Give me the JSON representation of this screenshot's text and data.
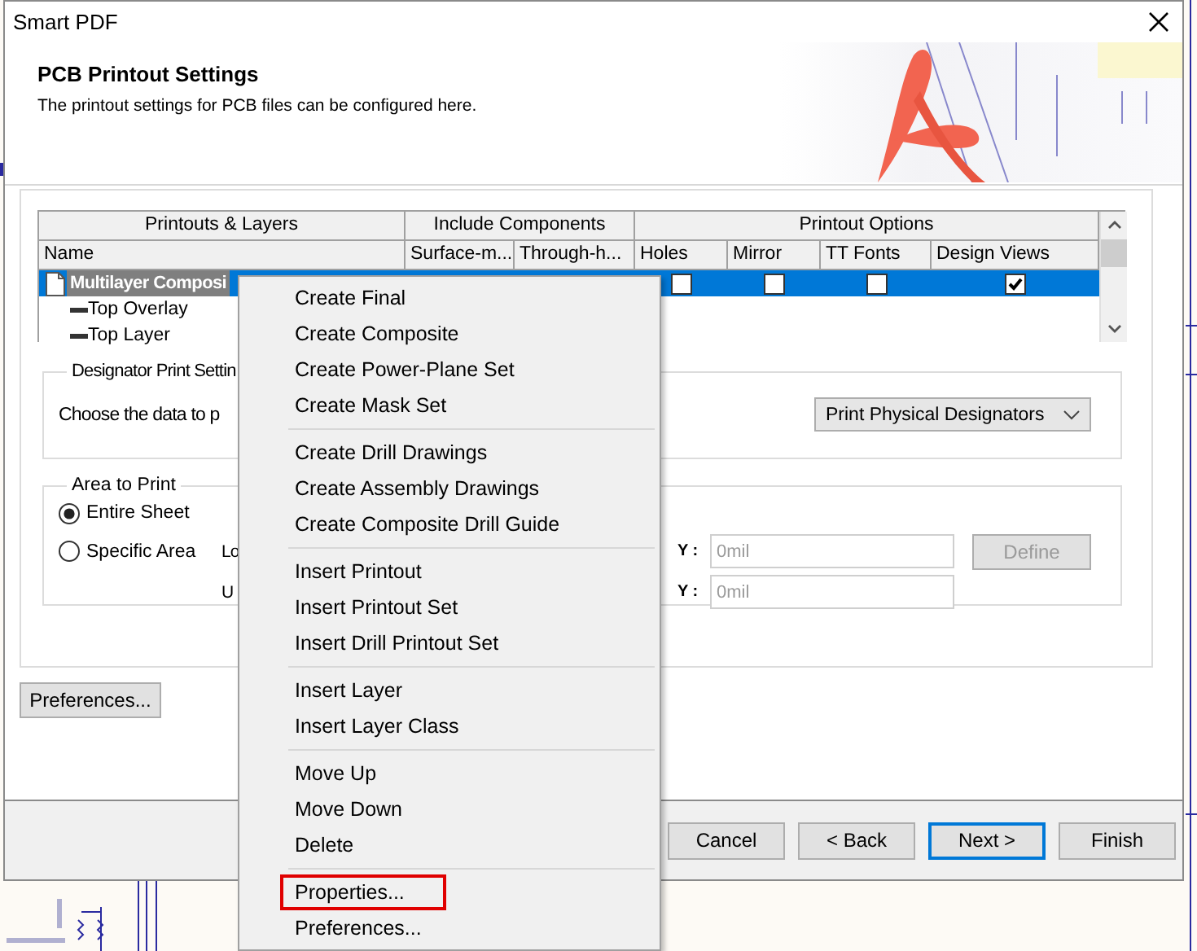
{
  "window": {
    "title": "Smart PDF"
  },
  "header": {
    "title": "PCB Printout Settings",
    "subtitle": "The printout settings for PCB files can be configured here."
  },
  "table": {
    "groups": [
      "Printouts & Layers",
      "Include Components",
      "Printout Options"
    ],
    "columns": [
      "Name",
      "Surface-m...",
      "Through-h...",
      "Holes",
      "Mirror",
      "TT Fonts",
      "Design Views"
    ],
    "rows": [
      {
        "kind": "printout",
        "name": "Multilayer Composi",
        "selected": true,
        "option_checks": [
          false,
          false,
          false,
          true
        ]
      },
      {
        "kind": "layer",
        "name": "Top Overlay",
        "selected": false
      },
      {
        "kind": "layer",
        "name": "Top Layer",
        "selected": false
      }
    ]
  },
  "designator": {
    "legend": "Designator Print Settin",
    "label": "Choose the data to p",
    "dropdown": {
      "value": "Print Physical Designators"
    }
  },
  "area": {
    "legend": "Area to Print",
    "options": [
      {
        "label": "Entire Sheet",
        "selected": true
      },
      {
        "label": "Specific Area",
        "selected": false
      }
    ],
    "lower_label": "Lo",
    "upper_label": "U",
    "fields": [
      {
        "label": "Y :",
        "value": "0mil",
        "disabled": true
      },
      {
        "label": "Y :",
        "value": "0mil",
        "disabled": true
      }
    ],
    "define_button": {
      "label": "Define",
      "disabled": true
    }
  },
  "preferences_button": "Preferences...",
  "footer_buttons": [
    {
      "label": "Cancel",
      "default": false
    },
    {
      "label": "< Back",
      "default": false
    },
    {
      "label": "Next >",
      "default": true
    },
    {
      "label": "Finish",
      "default": false
    }
  ],
  "context_menu": {
    "groups": [
      {
        "items": [
          {
            "label": "Create Final",
            "highlighted": false
          },
          {
            "label": "Create Composite",
            "highlighted": false
          },
          {
            "label": "Create Power-Plane Set",
            "highlighted": false
          },
          {
            "label": "Create Mask Set",
            "highlighted": false
          }
        ]
      },
      {
        "items": [
          {
            "label": "Create Drill Drawings",
            "highlighted": false
          },
          {
            "label": "Create Assembly Drawings",
            "highlighted": false
          },
          {
            "label": "Create Composite Drill Guide",
            "highlighted": false
          }
        ]
      },
      {
        "items": [
          {
            "label": "Insert Printout",
            "highlighted": false
          },
          {
            "label": "Insert Printout Set",
            "highlighted": false
          },
          {
            "label": "Insert Drill Printout Set",
            "highlighted": false
          }
        ]
      },
      {
        "items": [
          {
            "label": "Insert Layer",
            "highlighted": false
          },
          {
            "label": "Insert Layer Class",
            "highlighted": false
          }
        ]
      },
      {
        "items": [
          {
            "label": "Move Up",
            "highlighted": false
          },
          {
            "label": "Move Down",
            "highlighted": false
          },
          {
            "label": "Delete",
            "highlighted": false
          }
        ]
      },
      {
        "items": [
          {
            "label": "Properties...",
            "highlighted": true
          },
          {
            "label": "Preferences...",
            "highlighted": false
          }
        ]
      }
    ]
  }
}
